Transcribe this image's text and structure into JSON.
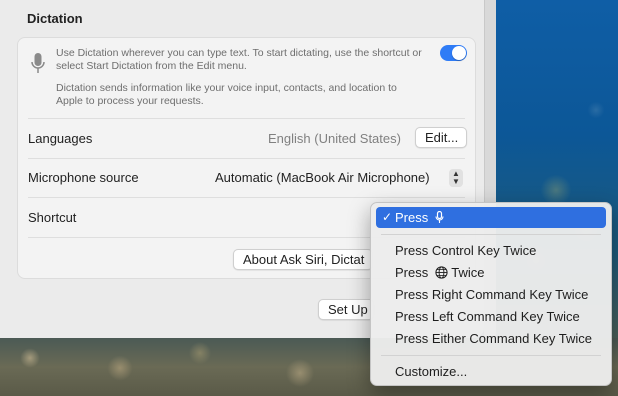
{
  "section": {
    "title": "Dictation"
  },
  "dictation": {
    "description": "Use Dictation wherever you can type text. To start dictating, use the shortcut or select Start Dictation from the Edit menu.",
    "privacy_note": "Dictation sends information like your voice input, contacts, and location to Apple to process your requests.",
    "enabled": true,
    "accent_color": "#2f7cf6"
  },
  "languages": {
    "label": "Languages",
    "value": "English (United States)",
    "edit_button": "Edit..."
  },
  "microphone": {
    "label": "Microphone source",
    "value": "Automatic (MacBook Air Microphone)"
  },
  "shortcut": {
    "label": "Shortcut"
  },
  "about_button": "About Ask Siri, Dictat",
  "setup_button": "Set Up",
  "shortcut_menu": {
    "selected_check": "✓",
    "items": [
      {
        "label": "Press",
        "icon": "mic-icon",
        "selected": true
      },
      {
        "label": "Press Control Key Twice"
      },
      {
        "label": "Press",
        "icon": "globe-icon",
        "suffix": "Twice"
      },
      {
        "label": "Press Right Command Key Twice"
      },
      {
        "label": "Press Left Command Key Twice"
      },
      {
        "label": "Press Either Command Key Twice"
      },
      {
        "label": "Customize..."
      }
    ],
    "highlight_color": "#2f6fe0"
  }
}
